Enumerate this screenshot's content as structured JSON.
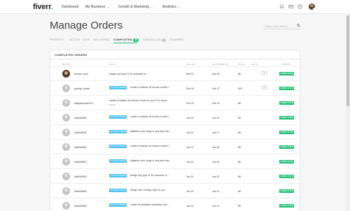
{
  "nav": {
    "logo": "fiverr",
    "logo_dot": ".",
    "dashboard": "Dashboard",
    "my_business": "My Business",
    "growth": "Growth & Marketing",
    "analytics": "Analytics",
    "chev": "⌄"
  },
  "page": {
    "title": "Manage Orders",
    "search_placeholder": "Search My History..."
  },
  "tabs": [
    {
      "label": "PRIORITY"
    },
    {
      "label": "ACTIVE"
    },
    {
      "label": "LATE"
    },
    {
      "label": "DELIVERED"
    },
    {
      "label": "COMPLETED",
      "count": "46"
    },
    {
      "label": "CANCELLED",
      "count": "1"
    },
    {
      "label": "STARRED"
    }
  ],
  "table": {
    "title": "COMPLETED ORDERS",
    "headers": {
      "buyer": "BUYER",
      "gig": "GIG ▼",
      "due": "DUE ON",
      "delivered": "DELIVERED AT",
      "total": "TOTAL",
      "note": "NOTE",
      "status": "STATUS"
    },
    "tag_text": "CUSTOM ORDER",
    "status_text": "COMPLETED",
    "rows": [
      {
        "initial": "",
        "buyer": "benson_dom",
        "gig": "design any type of 3d character in ...",
        "due": "Mar 02",
        "delivered": "Mar 02",
        "total": "$6",
        "note": "1",
        "has_tag": false,
        "photo": true
      },
      {
        "initial": "A",
        "buyer": "ayodeji_studio",
        "gig": "create a realistic 3d human model f...",
        "due": "Feb 09",
        "delivered": "Feb 07",
        "total": "$10",
        "note": "1",
        "has_tag": true,
        "photo": false
      },
      {
        "initial": "B",
        "buyer": "bilalpakmusic070",
        "gig": "create a realistic 3d human model for you in 24 hours",
        "sub": "Details",
        "due": "Feb 03",
        "delivered": "Feb 01",
        "total": "$5",
        "note": "",
        "has_tag": false,
        "photo": false
      },
      {
        "initial": "B",
        "buyer": "bilal348081",
        "gig": "create a realistic 3d human model f...",
        "due": "Jan 22",
        "delivered": "Jan 21",
        "total": "$6",
        "note": "",
        "has_tag": true,
        "photo": false
      },
      {
        "initial": "B",
        "buyer": "bilal348081",
        "gig": "digitalize your sings or any pets into...",
        "due": "Jan 21",
        "delivered": "Jan 17",
        "total": "$6",
        "note": "",
        "has_tag": true,
        "photo": false
      },
      {
        "initial": "B",
        "buyer": "bilal348081",
        "gig": "create a realistic 3d human model f...",
        "due": "Jan 21",
        "delivered": "Jan 18",
        "total": "$5",
        "note": "",
        "has_tag": true,
        "photo": false
      },
      {
        "initial": "B",
        "buyer": "bilal348081",
        "gig": "digitalize your sings or any pets into...",
        "due": "Jan 21",
        "delivered": "Jan 20",
        "total": "$6",
        "note": "",
        "has_tag": true,
        "photo": false
      },
      {
        "initial": "B",
        "buyer": "bilal348081",
        "gig": "design any type of 3d character in ...",
        "due": "Jan 21",
        "delivered": "Jan 21",
        "total": "$6",
        "note": "",
        "has_tag": true,
        "photo": false
      },
      {
        "initial": "B",
        "buyer": "bilal348081",
        "gig": "design retro vintage logo for you",
        "due": "Jan 21",
        "delivered": "Jan 21",
        "total": "$6",
        "note": "",
        "has_tag": true,
        "photo": false
      },
      {
        "initial": "B",
        "buyer": "bilal348081",
        "gig": "create 3d printable characters and ...",
        "due": "Jan 21",
        "delivered": "Jan 21",
        "total": "$6",
        "note": "",
        "has_tag": true,
        "photo": false
      }
    ]
  }
}
